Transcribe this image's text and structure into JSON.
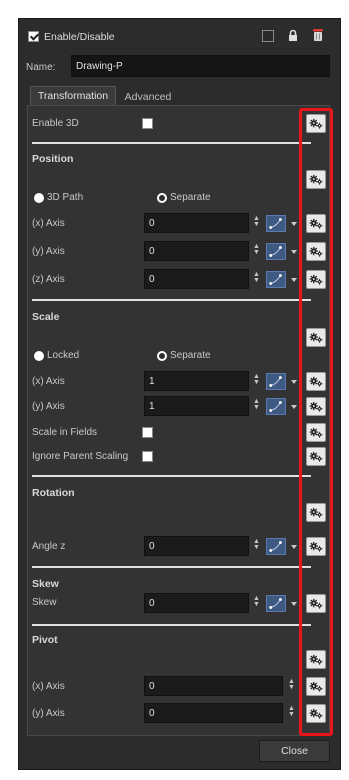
{
  "header": {
    "enable_label": "Enable/Disable",
    "enabled": true
  },
  "name": {
    "label": "Name:",
    "value": "Drawing-P"
  },
  "tabs": [
    {
      "label": "Transformation",
      "active": true
    },
    {
      "label": "Advanced",
      "active": false
    }
  ],
  "enable3d": {
    "label": "Enable 3D"
  },
  "position": {
    "title": "Position",
    "mode_3d": "3D Path",
    "mode_sep": "Separate",
    "x": {
      "label": "(x) Axis",
      "value": "0"
    },
    "y": {
      "label": "(y) Axis",
      "value": "0"
    },
    "z": {
      "label": "(z) Axis",
      "value": "0"
    }
  },
  "scale": {
    "title": "Scale",
    "mode_locked": "Locked",
    "mode_sep": "Separate",
    "x": {
      "label": "(x) Axis",
      "value": "1"
    },
    "y": {
      "label": "(y) Axis",
      "value": "1"
    },
    "fields_label": "Scale in Fields",
    "ignore_label": "Ignore Parent Scaling"
  },
  "rotation": {
    "title": "Rotation",
    "angle_label": "Angle z",
    "angle_value": "0"
  },
  "skew": {
    "title": "Skew",
    "label": "Skew",
    "value": "0"
  },
  "pivot": {
    "title": "Pivot",
    "x": {
      "label": "(x) Axis",
      "value": "0"
    },
    "y": {
      "label": "(y) Axis",
      "value": "0"
    }
  },
  "footer": {
    "close_label": "Close"
  },
  "highlight_color": "#e8161b"
}
